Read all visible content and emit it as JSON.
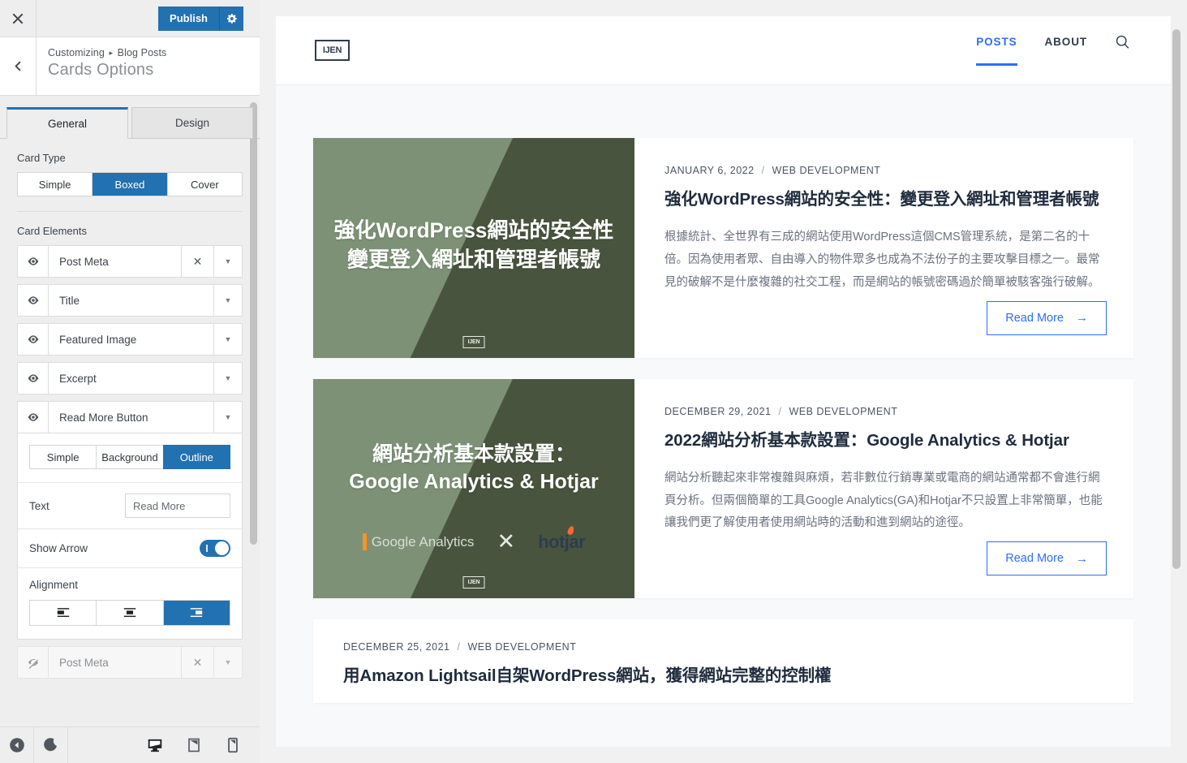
{
  "customizer": {
    "close_label": "×",
    "publish_label": "Publish",
    "gear_name": "gear-icon",
    "breadcrumb_root": "Customizing",
    "breadcrumb_sep": "▸",
    "breadcrumb_section": "Blog Posts",
    "panel_title": "Cards Options",
    "tabs": [
      {
        "label": "General",
        "active": true
      },
      {
        "label": "Design",
        "active": false
      }
    ],
    "card_type": {
      "label": "Card Type",
      "options": [
        "Simple",
        "Boxed",
        "Cover"
      ],
      "selected": "Boxed"
    },
    "card_elements": {
      "label": "Card Elements",
      "rows": [
        {
          "label": "Post Meta",
          "visible": true,
          "has_close": true
        },
        {
          "label": "Title",
          "visible": true,
          "has_close": false
        },
        {
          "label": "Featured Image",
          "visible": true,
          "has_close": false
        },
        {
          "label": "Excerpt",
          "visible": true,
          "has_close": false
        },
        {
          "label": "Read More Button",
          "visible": true,
          "has_close": false
        }
      ],
      "trailing_row": {
        "label": "Post Meta",
        "visible": false,
        "has_close": true
      }
    },
    "read_more_panel": {
      "style_options": [
        "Simple",
        "Background",
        "Outline"
      ],
      "style_selected": "Outline",
      "text_label": "Text",
      "text_value": "Read More",
      "show_arrow_label": "Show Arrow",
      "show_arrow_on": true,
      "alignment_label": "Alignment",
      "alignment_options": [
        "align-left",
        "align-center",
        "align-right"
      ],
      "alignment_selected": "align-right"
    },
    "footer": {
      "collapse_name": "collapse-sidebar-icon",
      "dark_mode_name": "moon-icon",
      "devices": [
        {
          "name": "desktop-preview-icon",
          "active": true
        },
        {
          "name": "tablet-preview-icon",
          "active": false
        },
        {
          "name": "mobile-preview-icon",
          "active": false
        }
      ]
    },
    "accent_color": "#2271b1"
  },
  "preview": {
    "site": {
      "logo_text": "IJEN",
      "nav": [
        {
          "label": "POSTS",
          "active": true
        },
        {
          "label": "ABOUT",
          "active": false
        }
      ],
      "search_name": "search-icon",
      "link_color": "#2d6ef5"
    },
    "posts": [
      {
        "date": "JANUARY 6, 2022",
        "separator": "/",
        "category": "WEB DEVELOPMENT",
        "title": "強化WordPress網站的安全性：變更登入網址和管理者帳號",
        "excerpt": "根據統計、全世界有三成的網站使用WordPress這個CMS管理系統，是第二名的十倍。因為使用者眾、自由導入的物件眾多也成為不法份子的主要攻擊目標之一。最常見的破解不是什麼複雜的社交工程，而是網站的帳號密碼過於簡單被駭客強行破解。",
        "read_more": "Read More",
        "arrow": "→",
        "thumb": {
          "line1": "強化WordPress網站的安全性",
          "line2": "變更登入網址和管理者帳號",
          "logo_text": "IJEN",
          "font_size": "26px",
          "brands": false
        }
      },
      {
        "date": "DECEMBER 29, 2021",
        "separator": "/",
        "category": "WEB DEVELOPMENT",
        "title": "2022網站分析基本款設置：Google Analytics & Hotjar",
        "excerpt": "網站分析聽起來非常複雜與麻煩，若非數位行銷專業或電商的網站通常都不會進行網頁分析。但兩個簡單的工具Google Analytics(GA)和Hotjar不只設置上非常簡單，也能讓我們更了解使用者使用網站時的活動和進到網站的途徑。",
        "read_more": "Read More",
        "arrow": "→",
        "thumb": {
          "line1": "網站分析基本款設置：",
          "line2": "Google Analytics & Hotjar",
          "logo_text": "IJEN",
          "font_size": "25px",
          "brands": true,
          "brand_ga": "Google Analytics",
          "brand_x": "✕",
          "brand_hotjar": "hotjar"
        }
      },
      {
        "date": "DECEMBER 25, 2021",
        "separator": "/",
        "category": "WEB DEVELOPMENT",
        "title": "用Amazon Lightsail自架WordPress網站，獲得網站完整的控制權"
      }
    ]
  }
}
